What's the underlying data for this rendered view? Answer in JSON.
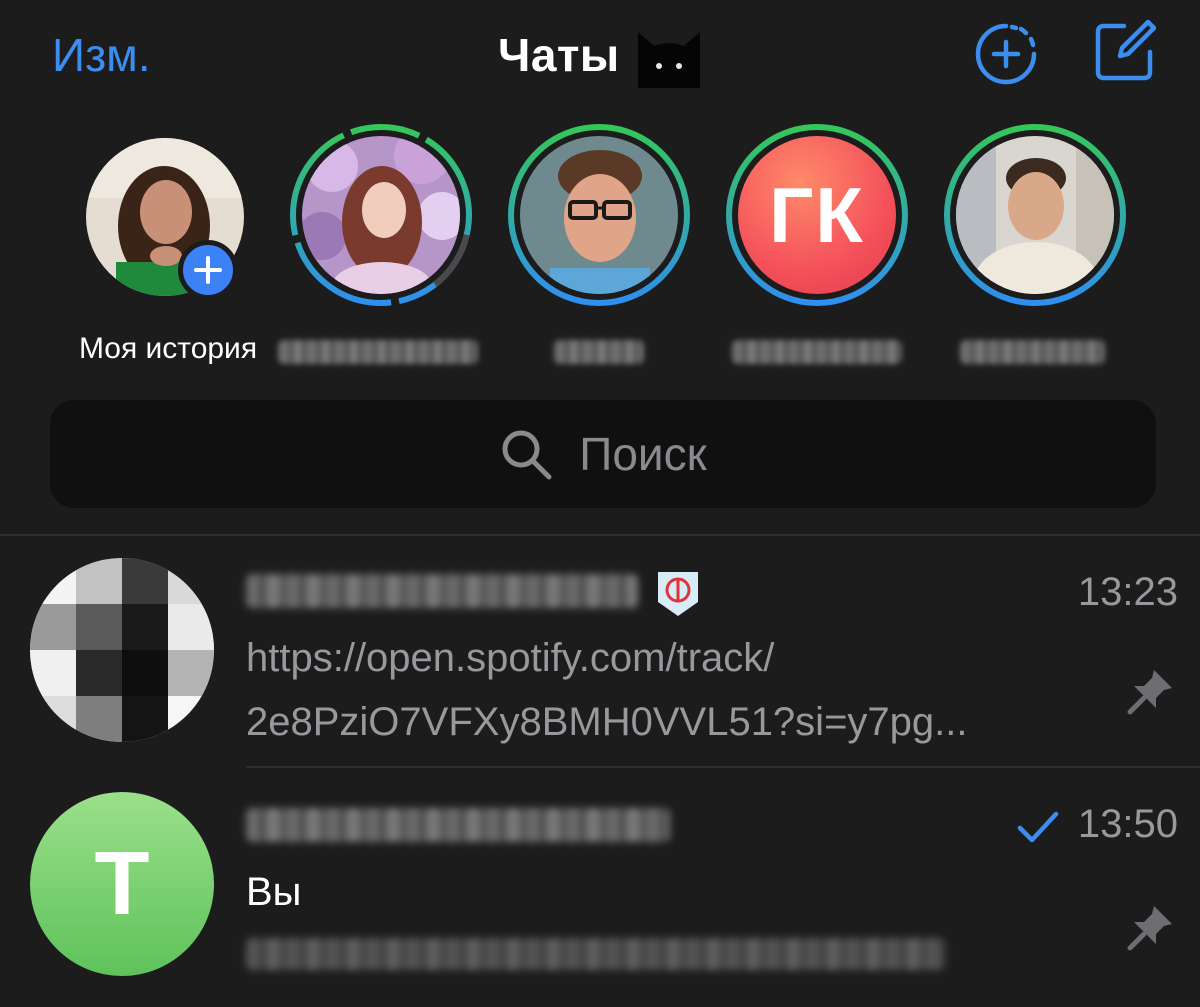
{
  "header": {
    "edit_label": "Изм.",
    "title": "Чаты",
    "title_emoji_icon": "black-cat-icon",
    "new_story_icon": "add-story-icon",
    "compose_icon": "compose-icon",
    "accent_color": "#3b8ef0"
  },
  "stories": {
    "my_story_label": "Моя история",
    "items": [
      {
        "kind": "my-story",
        "label": "Моя история"
      },
      {
        "kind": "contact",
        "label": ""
      },
      {
        "kind": "contact",
        "label": ""
      },
      {
        "kind": "contact",
        "initials": "ГК",
        "label": ""
      },
      {
        "kind": "contact",
        "label": ""
      }
    ]
  },
  "search": {
    "placeholder": "Поиск"
  },
  "chats": [
    {
      "time": "13:23",
      "badge_icon": "rebel-alliance-badge-icon",
      "message_line1": "https://open.spotify.com/track/",
      "message_line2": "2e8PziO7VFXy8BMH0VVL51?si=y7pg...",
      "pinned": true
    },
    {
      "avatar_initial": "Т",
      "time": "13:50",
      "read_status": "sent",
      "sender": "Вы",
      "pinned": true
    }
  ]
}
